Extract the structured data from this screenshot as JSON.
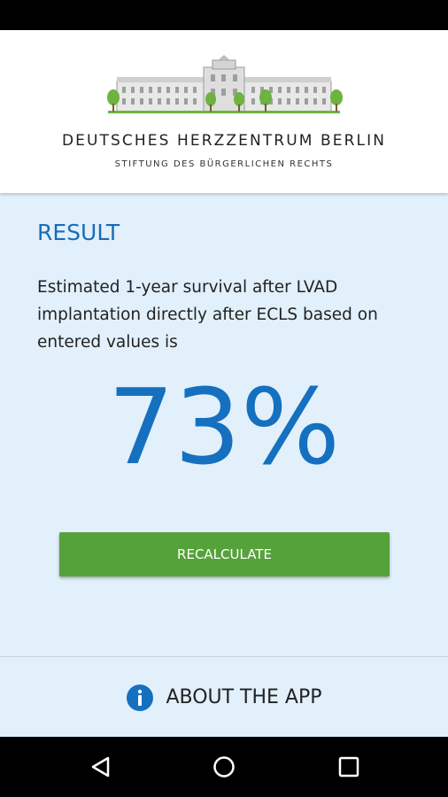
{
  "header": {
    "organization": "DEUTSCHES HERZZENTRUM BERLIN",
    "subtitle": "STIFTUNG DES BÜRGERLICHEN RECHTS"
  },
  "result": {
    "title": "RESULT",
    "description": "Estimated 1-year survival after LVAD implantation directly after ECLS based on entered values is",
    "value": "73%"
  },
  "actions": {
    "recalculate_label": "RECALCULATE"
  },
  "footer": {
    "about_label": "ABOUT THE APP",
    "about_icon": "info-icon"
  },
  "navigation": {
    "icons": [
      "back-icon",
      "home-icon",
      "recents-icon"
    ]
  },
  "colors": {
    "accent_blue": "#1570bf",
    "button_green": "#55a23a",
    "content_background": "#e1f0fb"
  }
}
